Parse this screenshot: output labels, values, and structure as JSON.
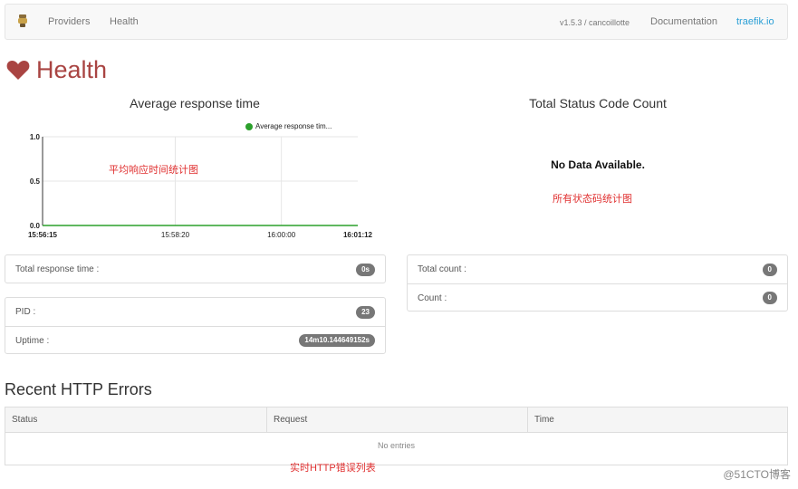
{
  "nav": {
    "providers": "Providers",
    "health": "Health",
    "version": "v1.5.3 / cancoillotte",
    "documentation": "Documentation",
    "site": "traefik.io"
  },
  "page": {
    "title": "Health"
  },
  "response_chart": {
    "title": "Average response time",
    "annotation": "平均响应时间统计图"
  },
  "status_chart": {
    "title": "Total Status Code Count",
    "no_data": "No Data Available.",
    "annotation": "所有状态码统计图"
  },
  "chart_data": {
    "type": "line",
    "title": "Average response time",
    "legend_position": "top-right",
    "series": [
      {
        "name": "Average response tim...",
        "color": "#2ca02c",
        "x": [
          "15:56:15",
          "15:58:20",
          "16:00:00",
          "16:01:12"
        ],
        "values": [
          0,
          0,
          0,
          0
        ]
      }
    ],
    "x_ticks": [
      "15:56:15",
      "15:58:20",
      "16:00:00",
      "16:01:12"
    ],
    "y_ticks": [
      "1.0",
      "0.5",
      "0.0"
    ],
    "ylim": [
      0,
      1
    ],
    "grid": true
  },
  "stats": {
    "total_response_time": {
      "label": "Total response time :",
      "value": "0s"
    },
    "pid": {
      "label": "PID :",
      "value": "23"
    },
    "uptime": {
      "label": "Uptime :",
      "value": "14m10.144649152s"
    },
    "total_count": {
      "label": "Total count :",
      "value": "0"
    },
    "count": {
      "label": "Count :",
      "value": "0"
    }
  },
  "errors": {
    "title": "Recent HTTP Errors",
    "columns": [
      "Status",
      "Request",
      "Time"
    ],
    "empty": "No entries",
    "annotation": "实时HTTP错误列表"
  },
  "watermark": "@51CTO博客",
  "colors": {
    "accent": "#a94442",
    "link": "#2a9fd6",
    "badge": "#777777",
    "annotation": "#e03030"
  }
}
